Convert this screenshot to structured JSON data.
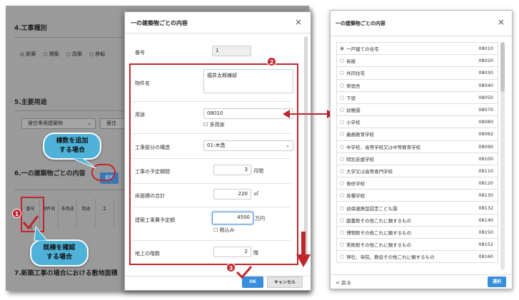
{
  "background": {
    "section4_title": "4.工事種別",
    "radios": [
      "◎ 新築",
      "○ 増築",
      "○ 改築",
      "○ 移転"
    ],
    "section5_title": "5.主要用途",
    "select1": "居住専用建築物",
    "select2": "居住",
    "section6_title": "6.一の建築物ごとの内容",
    "add_button": "追加",
    "table_headers": [
      "番号",
      "物件名",
      "多用途",
      "用途",
      "工"
    ],
    "row_number": "1",
    "section7_title": "7.新築工事の場合における敷地面積"
  },
  "callouts": {
    "add_building": "棟数を追加\nする場合",
    "confirm_existing": "既棟を確認\nする場合"
  },
  "badges": {
    "one": "1",
    "two": "2",
    "three": "3"
  },
  "modal": {
    "title": "一の建築物ごとの内容",
    "close": "×",
    "number_label": "番号",
    "number_value": "1",
    "property_label": "物件名",
    "property_value": "福井太郎様邸",
    "use_label": "用途",
    "use_value": "08010",
    "multi_use_label": "多用途",
    "structure_label": "工事部分の構造",
    "structure_value": "01-木造",
    "period_label": "工事の予定期間",
    "period_value": "3",
    "period_unit": "月間",
    "floor_area_label": "床面積の合計",
    "floor_area_value": "220",
    "floor_area_unit": "㎡",
    "cost_label": "建築工事費予定額",
    "cost_value": "4500",
    "cost_unit": "万円",
    "tax_label": "税込み",
    "floors_label": "地上の階数",
    "floors_value": "2",
    "floors_unit": "階",
    "ok": "OK",
    "cancel": "キャンセル"
  },
  "right_panel": {
    "title": "一の建築物ごとの内容",
    "close": "×",
    "items": [
      {
        "label": "一戸建ての住宅",
        "code": "08010",
        "selected": true
      },
      {
        "label": "長屋",
        "code": "08020",
        "selected": false
      },
      {
        "label": "共同住宅",
        "code": "08030",
        "selected": false
      },
      {
        "label": "寄宿舎",
        "code": "08040",
        "selected": false
      },
      {
        "label": "下宿",
        "code": "08050",
        "selected": false
      },
      {
        "label": "幼稚園",
        "code": "08070",
        "selected": false
      },
      {
        "label": "小学校",
        "code": "08080",
        "selected": false
      },
      {
        "label": "義務教育学校",
        "code": "08082",
        "selected": false
      },
      {
        "label": "中学校、高等学校又は中等教育学校",
        "code": "08090",
        "selected": false
      },
      {
        "label": "特別支援学校",
        "code": "08100",
        "selected": false
      },
      {
        "label": "大学又は高等専門学校",
        "code": "08110",
        "selected": false
      },
      {
        "label": "専修学校",
        "code": "08120",
        "selected": false
      },
      {
        "label": "各種学校",
        "code": "08130",
        "selected": false
      },
      {
        "label": "幼保連携型認定こども園",
        "code": "08132",
        "selected": false
      },
      {
        "label": "図書館その他これに類するもの",
        "code": "08140",
        "selected": false
      },
      {
        "label": "博物館その他これに類するもの",
        "code": "08150",
        "selected": false
      },
      {
        "label": "美術館その他これに類するもの",
        "code": "08152",
        "selected": false
      },
      {
        "label": "神社、寺院、教会その他これに類するもの",
        "code": "08160",
        "selected": false
      }
    ],
    "back": "< 戻る",
    "select_button": "選択"
  },
  "colors": {
    "accent_red": "#c0252b",
    "callout_blue": "#4fb3d9",
    "button_blue": "#3a8edb"
  }
}
